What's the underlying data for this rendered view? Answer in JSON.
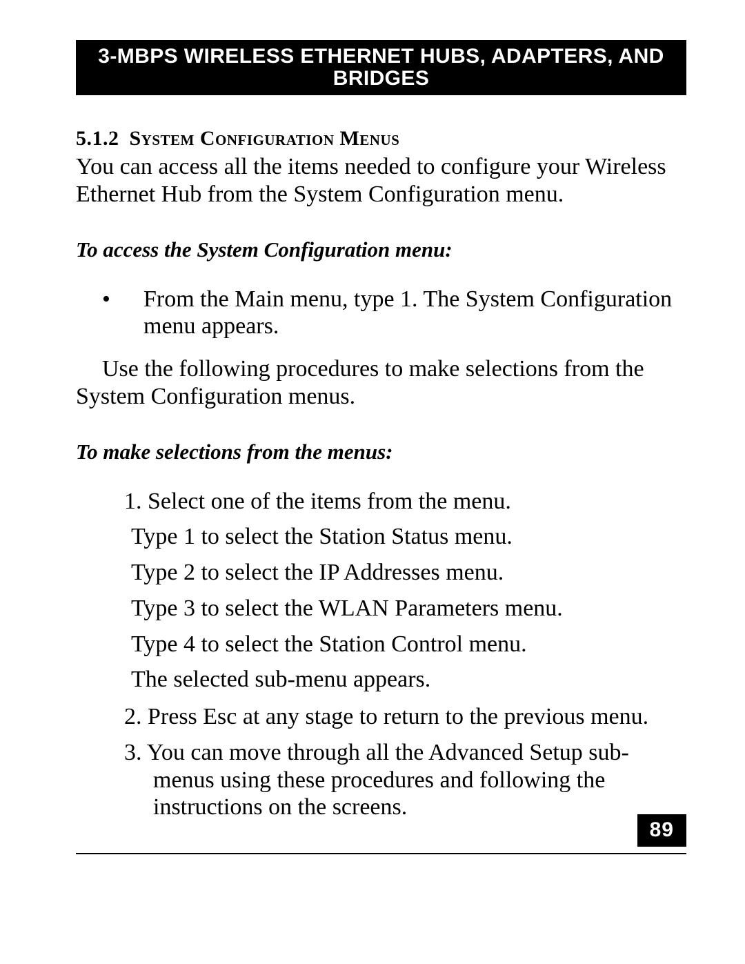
{
  "header": "3-MBPS WIRELESS ETHERNET HUBS, ADAPTERS, AND BRIDGES",
  "section": {
    "number": "5.1.2",
    "title": "System Configuration Menus"
  },
  "intro": "You can access all the items needed to configure your Wireless Ethernet Hub from the System Configuration menu.",
  "sub1_heading": "To access the System Configuration menu:",
  "bullet1": "From the Main menu, type 1.  The System Configuration menu appears.",
  "after_bullet": "Use the following procedures to make selections from the System Configuration menus.",
  "sub2_heading": "To make selections from the menus:",
  "list": {
    "item1_lead": "1.  Select one of the items from the menu.",
    "item1_lines": [
      "Type 1 to select the Station Status menu.",
      "Type 2 to select the IP Addresses menu.",
      "Type 3 to select the WLAN Parameters menu.",
      "Type 4 to select the Station Control menu.",
      "The selected sub-menu appears."
    ],
    "item2": "2.  Press Esc at any stage to return to the previous menu.",
    "item3": "3.  You can move through all the Advanced Setup sub-menus using these procedures and following the instructions on the screens."
  },
  "page_number": "89"
}
